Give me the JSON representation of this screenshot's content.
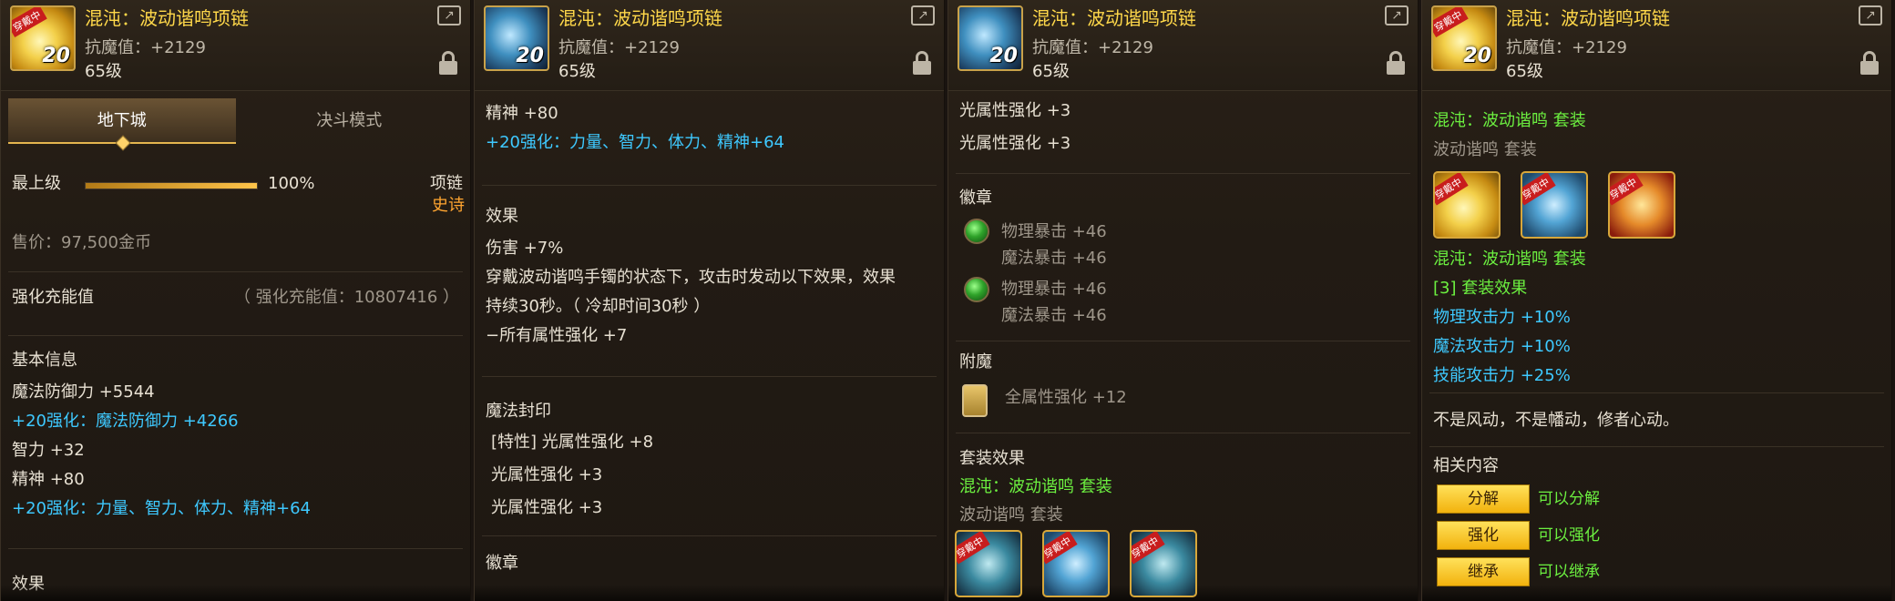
{
  "item": {
    "name": "混沌：波动谐鸣项链",
    "stat": "抗魔值：+2129",
    "level": "65级",
    "icon_badge": "20",
    "icon_tag": "穿戴中"
  },
  "tabs": [
    "地下城",
    "决斗模式"
  ],
  "panel1": {
    "grade_label": "最上级",
    "grade_pct": "100%",
    "grade_fill": 1.0,
    "slot": "项链",
    "rarity": "史诗",
    "price": "售价：97,500金币",
    "charge_label": "强化充能值",
    "charge_value": "（ 强化充能值：10807416 ）",
    "basic_title": "基本信息",
    "lines": [
      "魔法防御力 +5544",
      "+20强化：魔法防御力 +4266",
      "智力 +32",
      "精神 +80",
      "+20强化：力量、智力、体力、精神+64"
    ],
    "effect_title": "效果"
  },
  "panel2": {
    "top_lines": [
      "精神 +80",
      "+20强化：力量、智力、体力、精神+64"
    ],
    "effect_title": "效果",
    "effect_lines": [
      "伤害 +7%",
      "穿戴波动谐鸣手镯的状态下，攻击时发动以下效果，效果",
      "持续30秒。（ 冷却时间30秒 ）",
      "−所有属性强化 +7"
    ],
    "seal_title": "魔法封印",
    "seal_lines": [
      "[特性] 光属性强化 +8",
      "光属性强化 +3",
      "光属性强化 +3"
    ],
    "emblem_title": "徽章"
  },
  "panel3": {
    "top_lines": [
      "光属性强化 +3",
      "光属性强化 +3"
    ],
    "emblem_title": "徽章",
    "emblems": [
      {
        "a": "物理暴击 +46",
        "b": "魔法暴击 +46"
      },
      {
        "a": "物理暴击 +46",
        "b": "魔法暴击 +46"
      }
    ],
    "enchant_title": "附魔",
    "enchant_value": "全属性强化 +12",
    "set_title": "套装效果",
    "set_name": "混沌：波动谐鸣 套装",
    "set_sub": "波动谐鸣 套装"
  },
  "panel4": {
    "set_name": "混沌：波动谐鸣 套装",
    "set_sub": "波动谐鸣 套装",
    "set_name2": "混沌：波动谐鸣 套装",
    "set_effect_title": "[3] 套装效果",
    "set_effects": [
      "物理攻击力 +10%",
      "魔法攻击力 +10%",
      "技能攻击力 +25%"
    ],
    "flavor": "不是风动，不是幡动，修者心动。",
    "related_title": "相关内容",
    "related": [
      {
        "btn": "分解",
        "text": "可以分解"
      },
      {
        "btn": "强化",
        "text": "可以强化"
      },
      {
        "btn": "继承",
        "text": "可以继承"
      }
    ]
  },
  "colors": {
    "name": "#ffd84a",
    "cyan": "#3ec9ff",
    "green": "#6cf040",
    "rarity": "#ffa530"
  }
}
